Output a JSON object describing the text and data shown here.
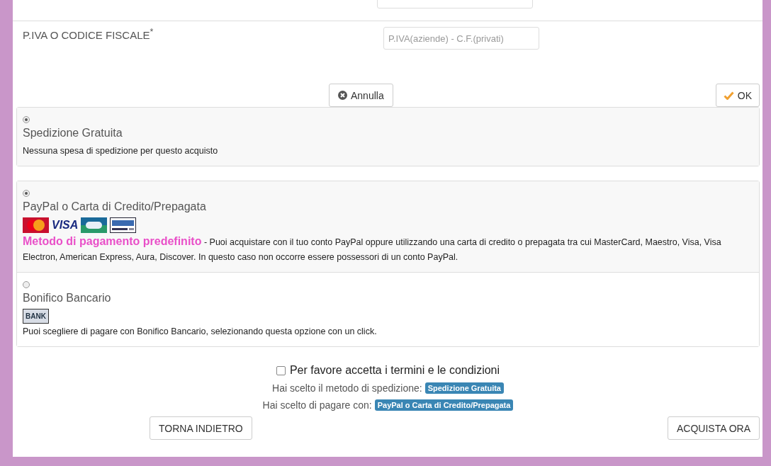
{
  "fields": [
    {
      "label": "P.IVA O CODICE FISCALE$^{*}$",
      "placeholder": "P.IVA(aziende) - C.F.(privati)"
    }
  ],
  "form_buttons": {
    "cancel": "Annulla",
    "ok": "OK"
  },
  "shipping": [
    {
      "title": "Spedizione Gratuita",
      "selected": true,
      "description": "Nessuna spesa di spedizione per questo acquisto"
    }
  ],
  "payment": [
    {
      "title": "PayPal o Carta di Credito/Prepagata",
      "selected": true,
      "logos": [
        {
          "kind": "mastercard"
        },
        {
          "kind": "visa",
          "label": "VISA"
        },
        {
          "kind": "cb"
        },
        {
          "kind": "paypal"
        }
      ],
      "description": "**Metodo di pagamento predefinito** - Puoi acquistare con il tuo conto PayPal oppure utilizzando una carta di credito o prepagata tra cui MasterCard, Maestro, Visa, Visa Electron, American Express, Aura, Discover. In questo caso non occorre essere possessori di un conto PayPal."
    },
    {
      "title": "Bonifico Bancario",
      "selected": false,
      "logos": [
        {
          "kind": "bank",
          "label": "BANK"
        }
      ],
      "description": "Puoi scegliere di pagare con Bonifico Bancario, selezionando questa opzione con un click."
    }
  ],
  "terms": {
    "label": "Per favore accetta i termini e le condizioni",
    "checked": false
  },
  "summary": [
    {
      "label": "Hai scelto il metodo di spedizione:",
      "badge": "Spedizione Gratuita"
    },
    {
      "label": "Hai scelto di pagare con:",
      "badge": "PayPal o Carta di Credito/Prepagata"
    }
  ],
  "nav_buttons": {
    "back": "TORNA INDIETRO",
    "buy": "ACQUISTA ORA"
  }
}
